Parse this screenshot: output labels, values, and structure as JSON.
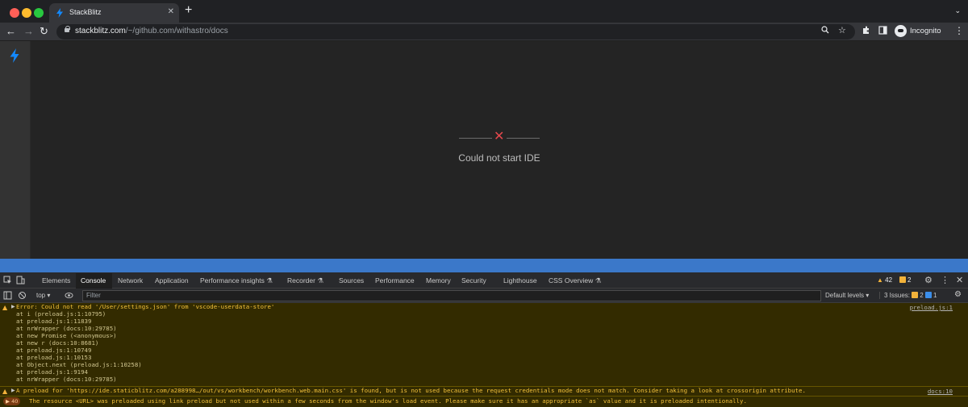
{
  "browser": {
    "tab_title": "StackBlitz",
    "tab_close": "✕",
    "new_tab": "+",
    "tab_menu": "⌄",
    "url_host": "stackblitz.com",
    "url_path": "/~/github.com/withastro/docs",
    "profile_label": "Incognito",
    "icons": [
      "back-icon",
      "forward-icon",
      "reload-icon",
      "lock-icon",
      "zoom-icon",
      "star-icon",
      "extensions-icon",
      "sidepanel-icon",
      "incognito-icon",
      "menu-icon"
    ]
  },
  "page": {
    "error_symbol": "✕",
    "error_message": "Could not start IDE",
    "accent_color": "#1389fd",
    "error_color": "#e5484d"
  },
  "devtools": {
    "tabs": [
      "Elements",
      "Console",
      "Network",
      "Application",
      "Performance insights ⚗",
      "Recorder ⚗",
      "Sources",
      "Performance",
      "Memory",
      "Security",
      "Lighthouse",
      "CSS Overview ⚗"
    ],
    "active_tab": "Console",
    "warning_count": "42",
    "issue_count": "2",
    "context": "top",
    "filter_placeholder": "Filter",
    "default_levels": "Default levels",
    "issues_label": "3 Issues:",
    "issues_warn": "2",
    "issues_info": "1"
  },
  "console": {
    "messages": [
      {
        "lines": [
          "Error: Could not read '/User/settings.json' from 'vscode-userdata-store'",
          "    at i (preload.js:1:10795)",
          "    at preload.js:1:11839",
          "    at nrWrapper (docs:10:29785)",
          "    at new Promise (<anonymous>)",
          "    at new r (docs:10:8681)",
          "    at preload.js:1:10749",
          "    at preload.js:1:10153",
          "    at Object.next (preload.js:1:10258)",
          "    at preload.js:1:9194",
          "    at nrWrapper (docs:10:29785)"
        ],
        "source": "preload.js:1"
      },
      {
        "text": "A preload for 'https://ide.staticblitz.com/a288998…/out/vs/workbench/workbench.web.main.css' is found, but is not used because the request credentials mode does not match. Consider taking a look at crossorigin attribute.",
        "source": "docs:10"
      },
      {
        "count": "40",
        "text": "The resource <URL> was preloaded using link preload but not used within a few seconds from the window's load event. Please make sure it has an appropriate `as` value and it is preloaded intentionally."
      }
    ]
  }
}
